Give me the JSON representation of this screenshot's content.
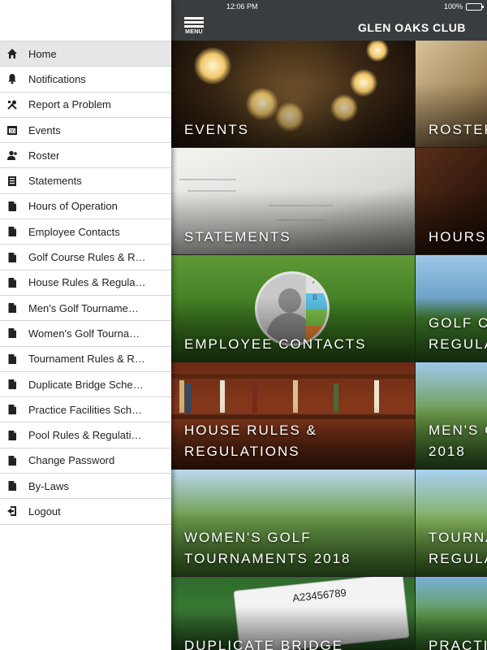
{
  "status": {
    "time": "12:06 PM",
    "battery": "100%"
  },
  "appbar": {
    "menu_label": "MENU",
    "title": "GLEN OAKS CLUB"
  },
  "sidebar": {
    "items": [
      {
        "label": "Home",
        "icon": "home-icon",
        "active": true
      },
      {
        "label": "Notifications",
        "icon": "bell-icon"
      },
      {
        "label": "Report a Problem",
        "icon": "tools-icon"
      },
      {
        "label": "Events",
        "icon": "calendar-icon"
      },
      {
        "label": "Roster",
        "icon": "people-icon"
      },
      {
        "label": "Statements",
        "icon": "statement-icon"
      },
      {
        "label": "Hours of Operation",
        "icon": "document-icon"
      },
      {
        "label": "Employee Contacts",
        "icon": "document-icon"
      },
      {
        "label": "Golf Course Rules & R…",
        "icon": "document-icon"
      },
      {
        "label": "House Rules & Regula…",
        "icon": "document-icon"
      },
      {
        "label": "Men's Golf Tourname…",
        "icon": "document-icon"
      },
      {
        "label": "Women's Golf Tourna…",
        "icon": "document-icon"
      },
      {
        "label": "Tournament Rules & R…",
        "icon": "document-icon"
      },
      {
        "label": "Duplicate Bridge Sche…",
        "icon": "document-icon"
      },
      {
        "label": "Practice Facilities Sch…",
        "icon": "document-icon"
      },
      {
        "label": "Pool Rules & Regulati…",
        "icon": "document-icon"
      },
      {
        "label": "Change Password",
        "icon": "document-icon"
      },
      {
        "label": "By-Laws",
        "icon": "document-icon"
      },
      {
        "label": "Logout",
        "icon": "logout-icon"
      }
    ]
  },
  "tiles": {
    "events": {
      "line1": "EVENTS"
    },
    "roster": {
      "line1": "ROSTER"
    },
    "statements": {
      "line1": "STATEMENTS"
    },
    "hours": {
      "line1": "HOURS"
    },
    "employee": {
      "line1": "EMPLOYEE CONTACTS"
    },
    "golf": {
      "line1": "GOLF CO",
      "line2": "REGULA"
    },
    "house": {
      "line1": "HOUSE RULES &",
      "line2": "REGULATIONS"
    },
    "mens": {
      "line1": "MEN'S G",
      "line2": "2018"
    },
    "womens": {
      "line1": "WOMEN'S GOLF",
      "line2": "TOURNAMENTS 2018"
    },
    "tourn": {
      "line1": "TOURNA",
      "line2": "REGULA"
    },
    "bridge": {
      "line1": "DUPLICATE BRIDGE"
    },
    "practice": {
      "line1": "PRACTIC"
    }
  },
  "decor": {
    "avatar_tabs": [
      "A",
      "B"
    ],
    "card_ranks": "A23456789"
  },
  "colors": {
    "appbar": "#3a3d3f",
    "sidebar_active": "#e6e6e6",
    "icon": "#222222"
  }
}
